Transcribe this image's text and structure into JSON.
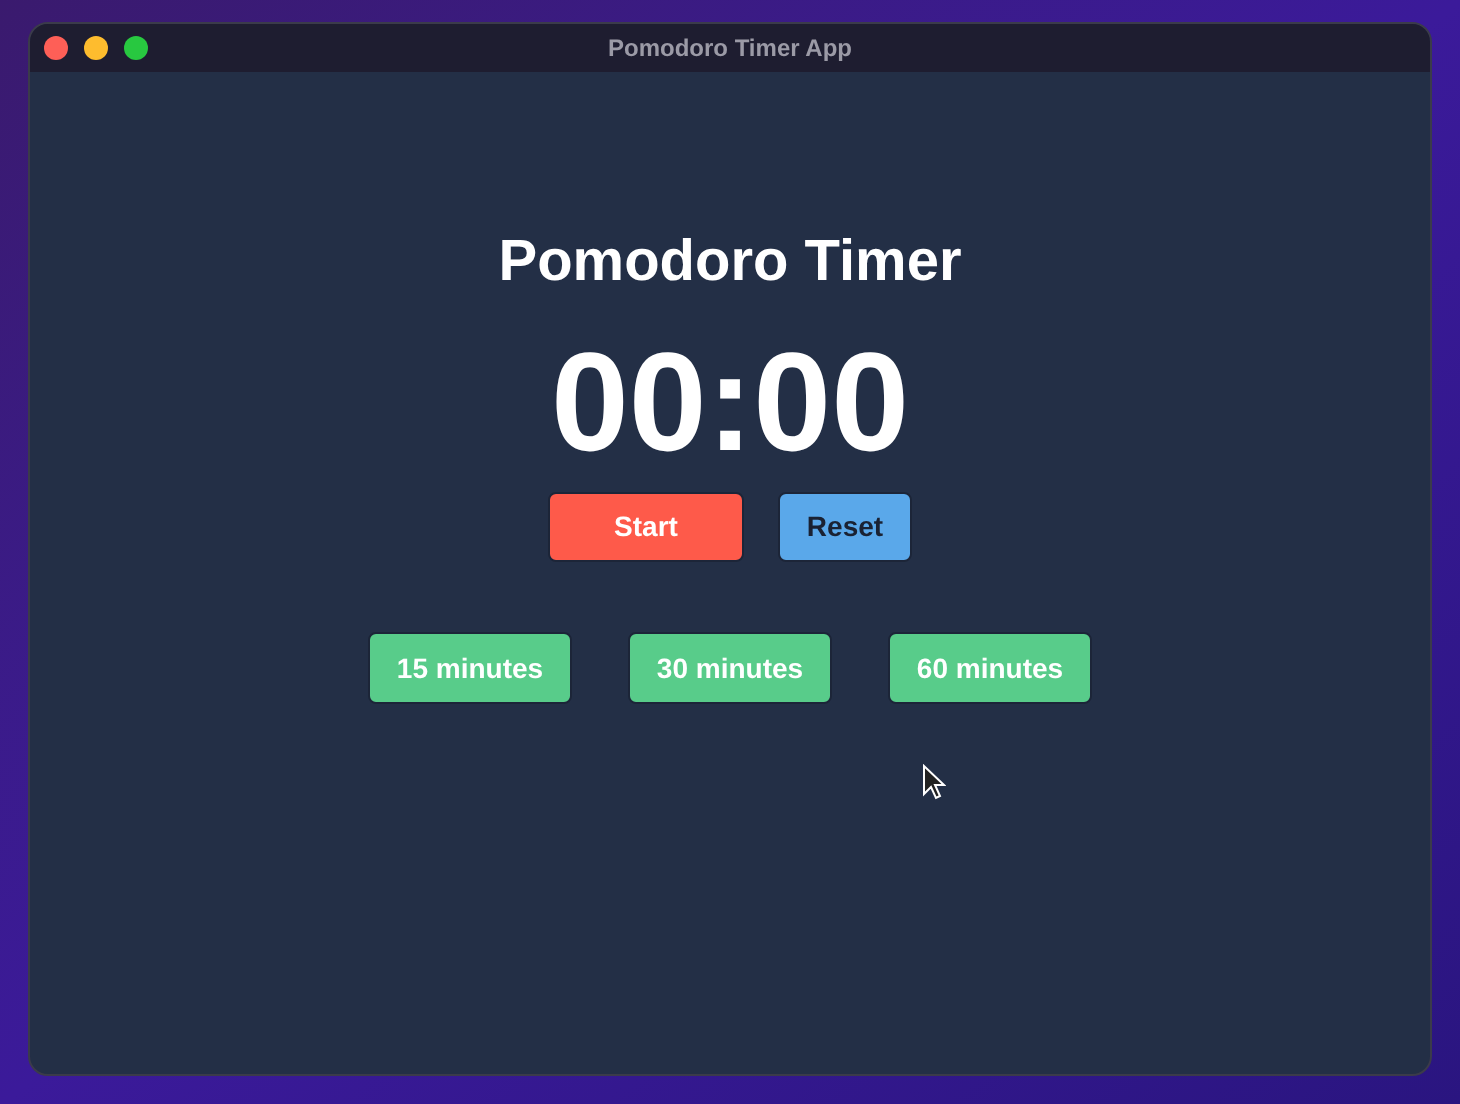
{
  "window": {
    "title": "Pomodoro Timer App"
  },
  "heading": "Pomodoro Timer",
  "time": "00:00",
  "controls": [
    {
      "label": "Start",
      "kind": "start"
    },
    {
      "label": "Reset",
      "kind": "reset"
    }
  ],
  "presets": [
    {
      "label": "15 minutes"
    },
    {
      "label": "30 minutes"
    },
    {
      "label": "60 minutes"
    }
  ]
}
